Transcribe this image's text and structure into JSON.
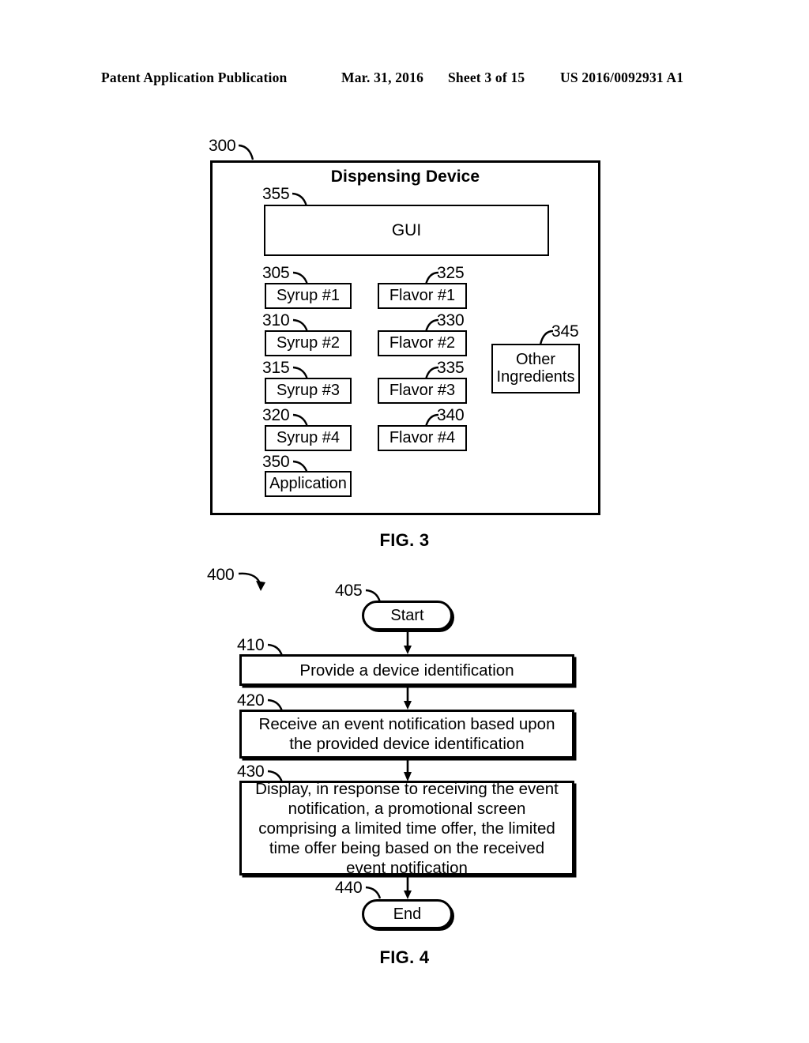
{
  "header": {
    "publication": "Patent Application Publication",
    "date": "Mar. 31, 2016",
    "sheet": "Sheet 3 of 15",
    "patent_number": "US 2016/0092931 A1"
  },
  "fig3": {
    "caption": "FIG. 3",
    "figure_ref": "300",
    "title": "Dispensing Device",
    "gui": {
      "ref": "355",
      "label": "GUI"
    },
    "syrups": [
      {
        "ref": "305",
        "label": "Syrup #1"
      },
      {
        "ref": "310",
        "label": "Syrup #2"
      },
      {
        "ref": "315",
        "label": "Syrup #3"
      },
      {
        "ref": "320",
        "label": "Syrup #4"
      }
    ],
    "flavors": [
      {
        "ref": "325",
        "label": "Flavor #1"
      },
      {
        "ref": "330",
        "label": "Flavor #2"
      },
      {
        "ref": "335",
        "label": "Flavor #3"
      },
      {
        "ref": "340",
        "label": "Flavor #4"
      }
    ],
    "other_ingredients": {
      "ref": "345",
      "line1": "Other",
      "line2": "Ingredients"
    },
    "application": {
      "ref": "350",
      "label": "Application"
    }
  },
  "fig4": {
    "caption": "FIG. 4",
    "figure_ref": "400",
    "start": {
      "ref": "405",
      "label": "Start"
    },
    "steps": [
      {
        "ref": "410",
        "text": "Provide a device identification"
      },
      {
        "ref": "420",
        "text": "Receive an event notification based upon the provided device identification"
      },
      {
        "ref": "430",
        "text": "Display, in response to receiving the event notification, a promotional screen comprising a limited time offer, the limited time offer being based on the received event notification"
      }
    ],
    "end": {
      "ref": "440",
      "label": "End"
    }
  },
  "colors": {
    "ink": "#000000",
    "paper": "#ffffff"
  }
}
